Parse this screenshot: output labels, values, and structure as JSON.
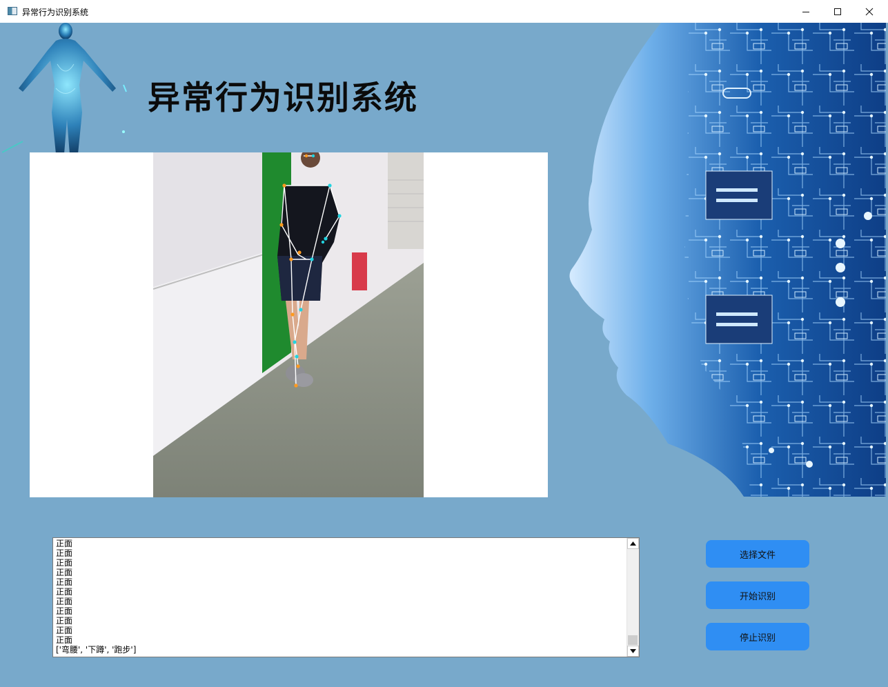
{
  "window": {
    "title": "异常行为识别系统",
    "controls": [
      "minimize-icon",
      "maximize-icon",
      "close-icon"
    ]
  },
  "app": {
    "title": "异常行为识别系统"
  },
  "log": {
    "lines": [
      "正面",
      "正面",
      "正面",
      "正面",
      "正面",
      "正面",
      "正面",
      "正面",
      "正面",
      "正面",
      "正面",
      "['弯腰', '下蹲', '跑步']"
    ],
    "scroll_position": 0.95
  },
  "buttons": {
    "select_file": "选择文件",
    "start": "开始识别",
    "stop": "停止识别"
  },
  "colors": {
    "background": "#78a9cb",
    "button": "#2f8ef3",
    "skeleton_line": "#ffffff",
    "keypoint_left": "#ff9a1f",
    "keypoint_right": "#22d3e0"
  }
}
